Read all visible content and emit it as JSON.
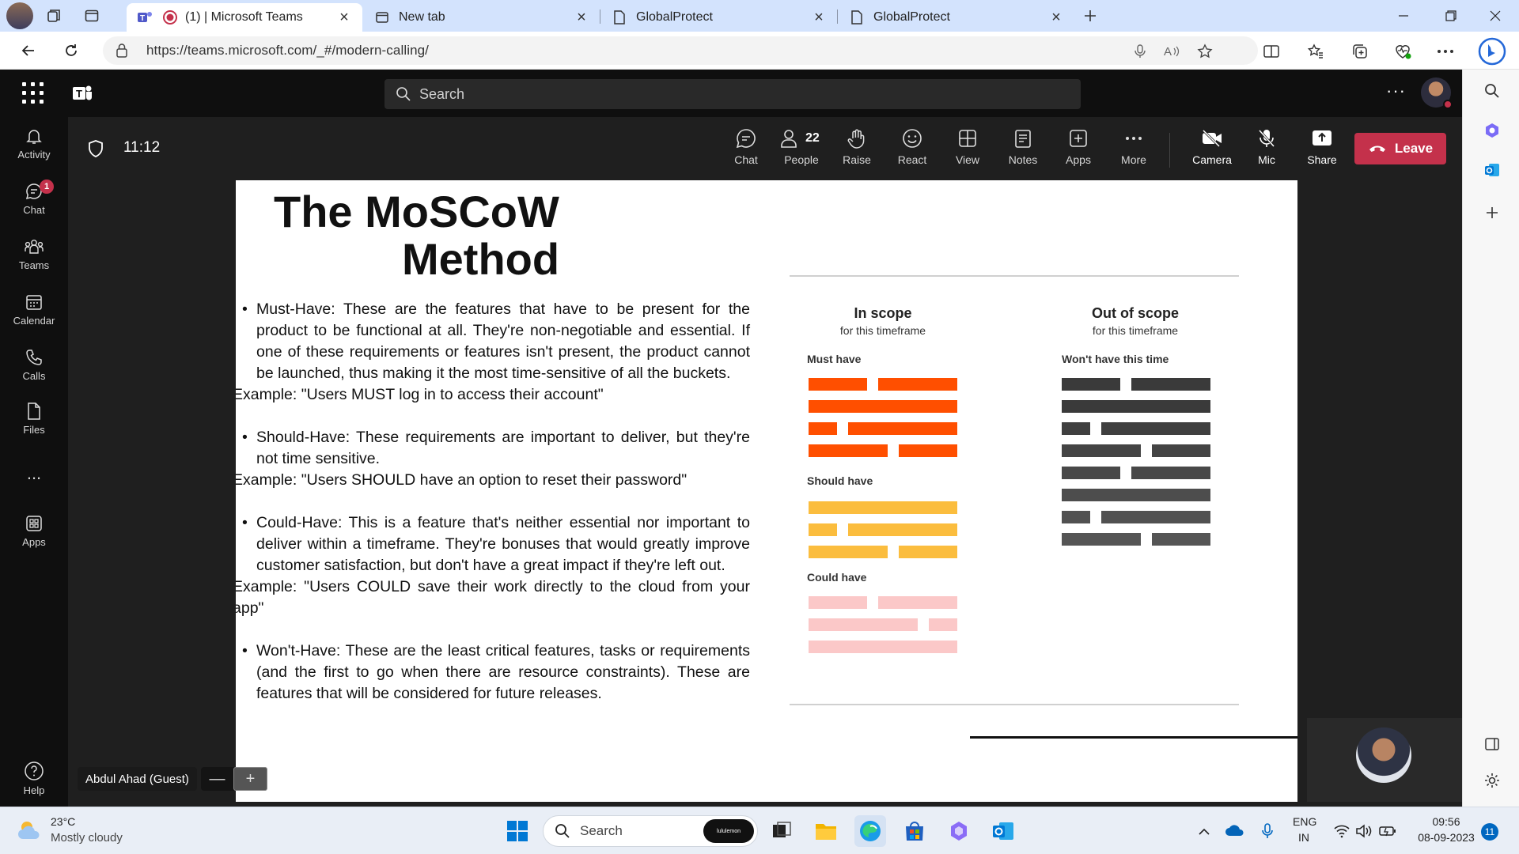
{
  "browser": {
    "tabs": [
      {
        "title": "(1) | Microsoft Teams"
      },
      {
        "title": "New tab"
      },
      {
        "title": "GlobalProtect"
      },
      {
        "title": "GlobalProtect"
      }
    ],
    "url": "https://teams.microsoft.com/_#/modern-calling/"
  },
  "teams": {
    "search_placeholder": "Search",
    "rail": [
      {
        "label": "Activity",
        "icon": "bell-icon"
      },
      {
        "label": "Chat",
        "icon": "chat-icon",
        "badge": "1"
      },
      {
        "label": "Teams",
        "icon": "teams-icon"
      },
      {
        "label": "Calendar",
        "icon": "calendar-icon"
      },
      {
        "label": "Calls",
        "icon": "phone-icon"
      },
      {
        "label": "Files",
        "icon": "file-icon"
      },
      {
        "label": "Apps",
        "icon": "apps-icon"
      },
      {
        "label": "Help",
        "icon": "help-icon"
      }
    ],
    "more_rail": "...",
    "meeting": {
      "time": "11:12",
      "people_count": "22",
      "toolbar": {
        "chat": "Chat",
        "people": "People",
        "raise": "Raise",
        "react": "React",
        "view": "View",
        "notes": "Notes",
        "apps": "Apps",
        "more": "More",
        "camera": "Camera",
        "mic": "Mic",
        "share": "Share",
        "leave": "Leave"
      },
      "participant_name": "Abdul Ahad (Guest)",
      "zoom_out": "—",
      "zoom_in": "+"
    }
  },
  "slide": {
    "title_line1": "The MoSCoW",
    "title_line2": "Method",
    "must_have": "Must-Have: These are the features that have to be present for the product to be functional at all. They're non-negotiable and essential. If one of these requirements or features isn't present, the product cannot be launched, thus making it the most time-sensitive of all the buckets.",
    "must_example": "Example: \"Users MUST log in to access their account\"",
    "should_have": "Should-Have: These requirements are important to deliver, but they're not time sensitive.",
    "should_example": "Example: \"Users SHOULD have an option to reset their password\"",
    "could_have": "Could-Have: This is a feature that's neither essential nor important to deliver within a timeframe. They're bonuses that would greatly improve customer satisfaction, but don't have a great impact if they're left out.",
    "could_example": "Example: \"Users COULD save their work directly to the cloud from your app\"",
    "wont_have": "Won't-Have: These are the least critical features, tasks or requirements (and the first to go when there are resource constraints). These are features that will be considered for future releases.",
    "diagram": {
      "in_scope": "In scope",
      "in_scope_sub": "for this timeframe",
      "out_scope": "Out of scope",
      "out_scope_sub": "for this timeframe",
      "must_have": "Must have",
      "should_have": "Should have",
      "could_have": "Could have",
      "wont_have": "Won't have this time",
      "colors": {
        "must": "#ff4f00",
        "should": "#fbbd3e",
        "could": "#fbc8c8",
        "wont": "#3a3a3a"
      }
    }
  },
  "taskbar": {
    "temp": "23°C",
    "weather": "Mostly cloudy",
    "search": "Search",
    "search_badge": "lululemon",
    "lang1": "ENG",
    "lang2": "IN",
    "time": "09:56",
    "date": "08-09-2023",
    "notifications": "11"
  }
}
